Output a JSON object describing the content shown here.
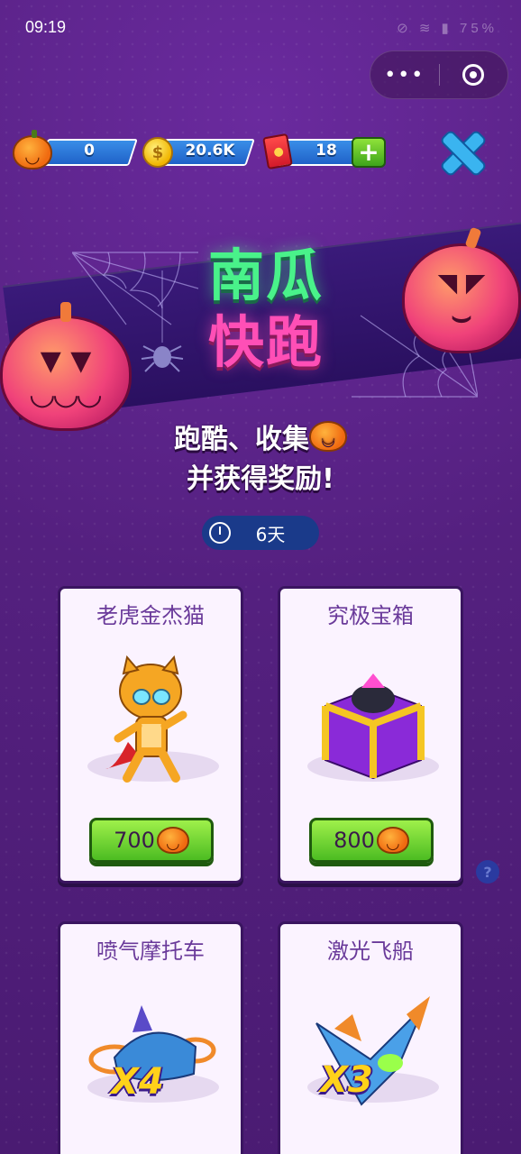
{
  "status_bar": {
    "time": "09:19",
    "icons_text": "⊘ ≋ ▮ 75%"
  },
  "capsule": {
    "more": "•••"
  },
  "currencies": {
    "pumpkins": "0",
    "coins": "20.6K",
    "coin_symbol": "$",
    "envelopes": "18",
    "plus_label": "+"
  },
  "banner": {
    "title_line1": "南瓜",
    "title_line2": "快跑",
    "subtitle_line1": "跑酷、收集",
    "subtitle_line2": "并获得奖励!"
  },
  "timer": {
    "text": "6天"
  },
  "cards": [
    {
      "title": "老虎金杰猫",
      "price": "700"
    },
    {
      "title": "究极宝箱",
      "price": "800"
    },
    {
      "title": "喷气摩托车",
      "multiplier": "X4"
    },
    {
      "title": "激光飞船",
      "multiplier": "X3"
    }
  ],
  "help": {
    "label": "?"
  },
  "colors": {
    "background": "#54207f",
    "title_green": "#49f28a",
    "title_pink": "#ff4fb6",
    "button_green": "#4cbc22",
    "currency_blue": "#1f62c8"
  }
}
